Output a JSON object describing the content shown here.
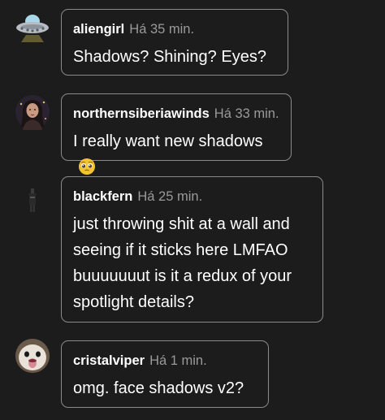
{
  "comments": [
    {
      "username": "aliengirl",
      "time": "Há 35 min.",
      "lines": [
        "Shadows? Shining? Eyes?"
      ],
      "avatar_icon": "ufo-icon"
    },
    {
      "username": "northernsiberiawinds",
      "time": "Há 33 min.",
      "lines": [
        "I really want new shadows"
      ],
      "emoji": "pleading-face-emoji",
      "avatar_icon": "portrait-avatar"
    },
    {
      "username": "blackfern",
      "time": "Há 25 min.",
      "lines": [
        "just throwing shit at a wall and",
        "seeing if it sticks here LMFAO",
        "buuuuuuut is it a redux of your",
        "spotlight details?"
      ],
      "avatar_icon": "figure-avatar"
    },
    {
      "username": "cristalviper",
      "time": "Há 1 min.",
      "lines": [
        "omg. face shadows v2?"
      ],
      "avatar_icon": "creature-avatar"
    }
  ],
  "colors": {
    "background": "#1c1c1c",
    "border": "#8a8a8a",
    "timestamp": "#9a9a9a",
    "text": "#ffffff"
  }
}
